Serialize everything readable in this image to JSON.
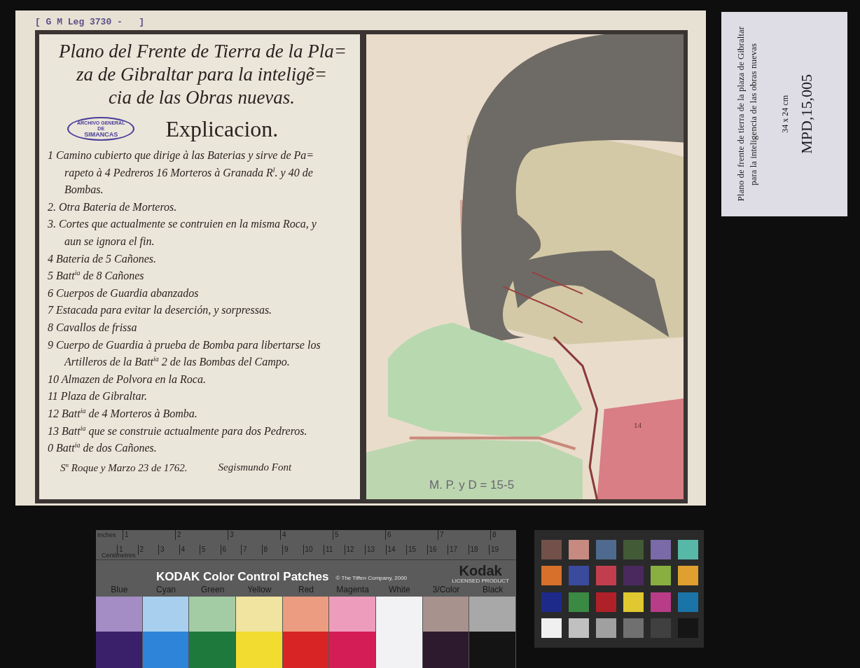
{
  "document": {
    "shelfmark": "[ G M Leg 3730 -   ]",
    "title_lines": [
      "Plano del Frente de Tierra de la Pla=",
      "za de Gibraltar para la inteligẽ=",
      "cia de las Obras nuevas."
    ],
    "stamp": {
      "lines": [
        "ARCHIVO GENERAL",
        "DE",
        "SIMANCAS"
      ]
    },
    "heading": "Explicacion.",
    "entries": [
      {
        "lines": [
          "1 Camino cubierto que dirige à las Baterias y sirve de Pa=",
          "rapeto à 4 Pedreros 16 Morteros à Granada R$^{l}$. y 40 de",
          "Bombas."
        ]
      },
      {
        "lines": [
          "2. Otra Bateria de Morteros."
        ]
      },
      {
        "lines": [
          "3. Cortes que actualmente se contruien en la misma Roca, y",
          "aun se ignora el fin."
        ]
      },
      {
        "lines": [
          "4 Bateria de 5 Cañones."
        ]
      },
      {
        "lines": [
          "5 Batt$^{ia}$ de 8 Cañones"
        ]
      },
      {
        "lines": [
          "6 Cuerpos de Guardia abanzados"
        ]
      },
      {
        "lines": [
          "7 Estacada para evitar la deserción, y sorpressas."
        ]
      },
      {
        "lines": [
          "8 Cavallos de frissa"
        ]
      },
      {
        "lines": [
          "9 Cuerpo de Guardia à prueba de Bomba para libertarse los",
          "Artilleros de la Batt$^{ia}$ 2 de las Bombas del Campo."
        ]
      },
      {
        "lines": [
          "10 Almazen de Polvora en la Roca."
        ]
      },
      {
        "lines": [
          "11 Plaza de Gibraltar."
        ]
      },
      {
        "lines": [
          "12 Batt$^{ia}$ de 4 Morteros à Bomba."
        ]
      },
      {
        "lines": [
          "13 Batt$^{ia}$ que se construie actualmente para dos Pedreros."
        ]
      },
      {
        "lines": [
          "0 Batt$^{ia}$ de dos Cañones."
        ]
      }
    ],
    "place_date": "S$^{n}$ Roque y Marzo 23 de 1762.",
    "signature": "Segismundo Font",
    "map": {
      "sea_label": "14",
      "pencil_note": "M. P. y D = 15-5"
    }
  },
  "label_card": {
    "description_lines": [
      "Plano de frente de tierra de la plaza de Gibraltar",
      "para la inteligencia de las obras nuevas"
    ],
    "size": "34 x 24 cm",
    "signature": "MPD,15,005"
  },
  "color_strip": {
    "inches_label": "Inches",
    "inches": [
      "1",
      "2",
      "3",
      "4",
      "5",
      "6",
      "7",
      "8"
    ],
    "centimetres_label": "Centimetres",
    "centimetres": [
      "1",
      "2",
      "3",
      "4",
      "5",
      "6",
      "7",
      "8",
      "9",
      "10",
      "11",
      "12",
      "13",
      "14",
      "15",
      "16",
      "17",
      "18",
      "19"
    ],
    "title": "KODAK Color Control Patches",
    "copyright": "© The Tiffen Company, 2000",
    "brand": "Kodak",
    "brand_note": "LICENSED PRODUCT",
    "patches": [
      {
        "name": "Blue",
        "tints": [
          {
            "color": "#a48cc4"
          },
          {
            "color": "#3a1f6a"
          }
        ]
      },
      {
        "name": "Cyan",
        "tints": [
          {
            "color": "#a8d0ee"
          },
          {
            "color": "#2e84d8"
          }
        ]
      },
      {
        "name": "Green",
        "tints": [
          {
            "color": "#a4cca4"
          },
          {
            "color": "#1e7a3c"
          }
        ]
      },
      {
        "name": "Yellow",
        "tints": [
          {
            "color": "#f0e4a0"
          },
          {
            "color": "#f2dc30"
          }
        ]
      },
      {
        "name": "Red",
        "tints": [
          {
            "color": "#ec9c80"
          },
          {
            "color": "#d82424"
          }
        ]
      },
      {
        "name": "Magenta",
        "tints": [
          {
            "color": "#ee9cbc"
          },
          {
            "color": "#d41c56"
          }
        ]
      },
      {
        "name": "White",
        "tints": [
          {
            "color": "#f2f2f4"
          },
          {
            "color": "#f2f2f4"
          }
        ]
      },
      {
        "name": "3/Color",
        "tints": [
          {
            "color": "#a8928e"
          },
          {
            "color": "#2e1a2e"
          }
        ]
      },
      {
        "name": "Black",
        "tints": [
          {
            "color": "#a8a8a8"
          },
          {
            "color": "#141414"
          }
        ]
      }
    ]
  },
  "color_checker": {
    "swatches": [
      {
        "color": "#73514a"
      },
      {
        "color": "#c78a80"
      },
      {
        "color": "#4e6a8e"
      },
      {
        "color": "#435a36"
      },
      {
        "color": "#7a6aa8"
      },
      {
        "color": "#58b8a8"
      },
      {
        "color": "#d6702a"
      },
      {
        "color": "#3a4a9c"
      },
      {
        "color": "#c23e4e"
      },
      {
        "color": "#4a2a5e"
      },
      {
        "color": "#88b040"
      },
      {
        "color": "#e0a030"
      },
      {
        "color": "#1e2a8a"
      },
      {
        "color": "#3a8a44"
      },
      {
        "color": "#b02028"
      },
      {
        "color": "#e0c830"
      },
      {
        "color": "#b83c88"
      },
      {
        "color": "#1a74a8"
      },
      {
        "color": "#f0f0f0"
      },
      {
        "color": "#c0c0c0"
      },
      {
        "color": "#a0a0a0"
      },
      {
        "color": "#707070"
      },
      {
        "color": "#404040"
      },
      {
        "color": "#151515"
      }
    ]
  }
}
